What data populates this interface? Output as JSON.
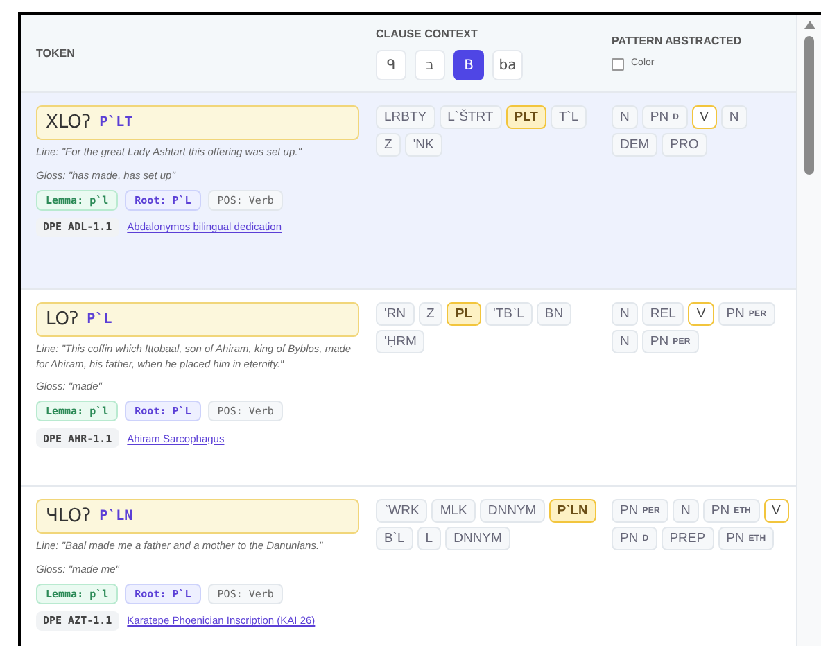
{
  "header": {
    "token": "TOKEN",
    "clause_context": "CLAUSE CONTEXT",
    "pattern_abstracted": "PATTERN ABSTRACTED",
    "color_toggle": {
      "label": "Color",
      "checked": false
    },
    "script_options": [
      {
        "label": "ᑫ",
        "selected": false
      },
      {
        "label": "ב",
        "selected": false
      },
      {
        "label": "B",
        "selected": true
      },
      {
        "label": "ba",
        "selected": false
      }
    ]
  },
  "rows": [
    {
      "selected": true,
      "script": "XLOʔ",
      "translit": "P`LT",
      "line": "Line: \"For the great Lady Ashtart this offering was set up.\"",
      "gloss": "Gloss: \"has made, has set up\"",
      "lemma": "Lemma: p`l",
      "root": "Root: P`L",
      "pos": "POS: Verb",
      "dpe": "DPE ADL-1.1",
      "source": "Abdalonymos bilingual dedication",
      "clause": [
        {
          "label": "LRBTY",
          "selected": false
        },
        {
          "label": "L`ŠTRT",
          "selected": false
        },
        {
          "label": "PLT",
          "selected": true
        },
        {
          "label": "T`L",
          "selected": false
        },
        {
          "label": "Z",
          "selected": false
        },
        {
          "label": "'NK",
          "selected": false
        }
      ],
      "pattern": [
        {
          "label": "N",
          "selected": false
        },
        {
          "label": "PN",
          "sub": "D",
          "selected": false
        },
        {
          "label": "V",
          "selected": true
        },
        {
          "label": "N",
          "selected": false
        },
        {
          "label": "DEM",
          "selected": false
        },
        {
          "label": "PRO",
          "selected": false
        }
      ]
    },
    {
      "selected": false,
      "script": "LOʔ",
      "translit": "P`L",
      "line": "Line: \"This coffin which Ittobaal, son of Ahiram, king of Byblos, made for Ahiram, his father, when he placed him in eternity.\"",
      "gloss": "Gloss: \"made\"",
      "lemma": "Lemma: p`l",
      "root": "Root: P`L",
      "pos": "POS: Verb",
      "dpe": "DPE AHR-1.1",
      "source": "Ahiram Sarcophagus",
      "clause": [
        {
          "label": "'RN",
          "selected": false
        },
        {
          "label": "Z",
          "selected": false
        },
        {
          "label": "PL",
          "selected": true
        },
        {
          "label": "'TB`L",
          "selected": false
        },
        {
          "label": "BN",
          "selected": false
        },
        {
          "label": "'ḤRM",
          "selected": false
        }
      ],
      "pattern": [
        {
          "label": "N",
          "selected": false
        },
        {
          "label": "REL",
          "selected": false
        },
        {
          "label": "V",
          "selected": true
        },
        {
          "label": "PN",
          "sub": "PER",
          "selected": false
        },
        {
          "label": "N",
          "selected": false
        },
        {
          "label": "PN",
          "sub": "PER",
          "selected": false
        }
      ]
    },
    {
      "selected": false,
      "script": "ЧLOʔ",
      "translit": "P`LN",
      "line": "Line: \"Baal made me a father and a mother to the Danunians.\"",
      "gloss": "Gloss: \"made me\"",
      "lemma": "Lemma: p`l",
      "root": "Root: P`L",
      "pos": "POS: Verb",
      "dpe": "DPE AZT-1.1",
      "source": "Karatepe Phoenician Inscription (KAI 26)",
      "clause": [
        {
          "label": "`WRK",
          "selected": false
        },
        {
          "label": "MLK",
          "selected": false
        },
        {
          "label": "DNNYM",
          "selected": false
        },
        {
          "label": "P`LN",
          "selected": true
        },
        {
          "label": "B`L",
          "selected": false
        },
        {
          "label": "L",
          "selected": false
        },
        {
          "label": "DNNYM",
          "selected": false
        }
      ],
      "pattern": [
        {
          "label": "PN",
          "sub": "PER",
          "selected": false
        },
        {
          "label": "N",
          "selected": false
        },
        {
          "label": "PN",
          "sub": "ETH",
          "selected": false
        },
        {
          "label": "V",
          "selected": true
        },
        {
          "label": "PN",
          "sub": "D",
          "selected": false
        },
        {
          "label": "PREP",
          "selected": false
        },
        {
          "label": "PN",
          "sub": "ETH",
          "selected": false
        }
      ]
    }
  ]
}
